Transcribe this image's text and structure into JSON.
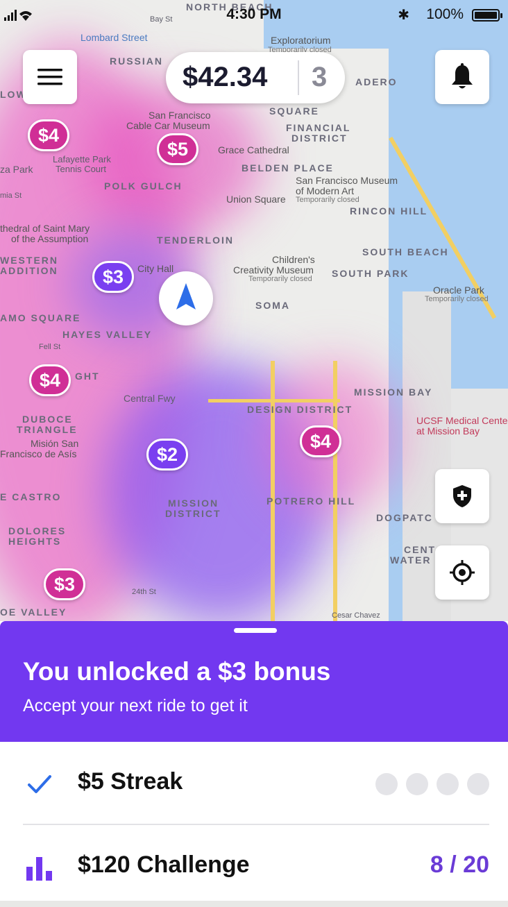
{
  "status_bar": {
    "time": "4:30 PM",
    "battery": "100%"
  },
  "header": {
    "earnings": "$42.34",
    "ride_count": "3"
  },
  "icons": {
    "menu": "menu-icon",
    "notifications": "bell-icon",
    "safety": "shield-icon",
    "recenter": "crosshair-icon",
    "location": "navigation-arrow-icon",
    "check": "check-icon",
    "challenge": "bar-chart-icon"
  },
  "map": {
    "labels": {
      "north_beach": "NORTH BEACH",
      "bay_st": "Bay St",
      "lombard": "Lombard Street",
      "exploratorium": "Exploratorium",
      "exploratorium_closed": "Temporarily closed",
      "russian": "RUSSIAN",
      "embarcadero": "ADERO",
      "square": "SQUARE",
      "financial": "FINANCIAL",
      "district": "DISTRICT",
      "cable_car_1": "San Francisco",
      "cable_car_2": "Cable Car Museum",
      "grace": "Grace Cathedral",
      "lafayette_1": "Lafayette Park",
      "lafayette_2": "Tennis Court",
      "belden": "BELDEN PLACE",
      "sfmoma_1": "San Francisco Museum",
      "sfmoma_2": "of Modern Art",
      "sfmoma_closed": "Temporarily closed",
      "polk_gulch": "POLK GULCH",
      "union_square": "Union Square",
      "rincon": "RINCON HILL",
      "cathedral_1": "thedral of Saint Mary",
      "cathedral_2": "of the Assumption",
      "tenderloin": "TENDERLOIN",
      "south_beach": "SOUTH BEACH",
      "western_1": "WESTERN",
      "western_2": "ADDITION",
      "city_hall": "City Hall",
      "childrens_1": "Children's",
      "childrens_2": "Creativity Museum",
      "childrens_closed": "Temporarily closed",
      "south_park": "SOUTH PARK",
      "oracle": "Oracle Park",
      "oracle_closed": "Temporarily closed",
      "soma": "SOMA",
      "alamo": "AMO SQUARE",
      "hayes": "HAYES VALLEY",
      "mission_bay": "MISSION BAY",
      "central_fwy": "Central Fwy",
      "duboce_1": "DUBOCE",
      "duboce_2": "TRIANGLE",
      "design": "DESIGN DISTRICT",
      "ucsf_1": "UCSF Medical Cente",
      "ucsf_2": "at Mission Bay",
      "mision_1": "Misión San",
      "mision_2": "Francisco de Asís",
      "castro": "E CASTRO",
      "potrero": "POTRERO HILL",
      "mission_d_1": "MISSION",
      "mission_d_2": "DISTRICT",
      "dogpatch": "DOGPATC",
      "dolores_1": "DOLORES",
      "dolores_2": "HEIGHTS",
      "central_w_1": "CENT",
      "central_w_2": "WATER",
      "noe": "OE VALLEY",
      "st_24": "24th St",
      "cesar": "Cesar Chavez",
      "park": "za Park",
      "mia": "mia St",
      "fell": "Fell St",
      "lo": "LOW",
      "ght": "GHT"
    }
  },
  "markers": [
    {
      "label": "$4",
      "color": "#d02f96"
    },
    {
      "label": "$5",
      "color": "#d02f96"
    },
    {
      "label": "$3",
      "color": "#7a3ff0"
    },
    {
      "label": "$4",
      "color": "#d02f96"
    },
    {
      "label": "$2",
      "color": "#7a3ff0"
    },
    {
      "label": "$4",
      "color": "#d02f96"
    },
    {
      "label": "$3",
      "color": "#d02f96"
    }
  ],
  "bonus": {
    "title": "You unlocked a $3 bonus",
    "subtitle": "Accept your next ride to get it",
    "color": "#7238f0"
  },
  "streak": {
    "label": "$5 Streak"
  },
  "challenge": {
    "label": "$120 Challenge",
    "progress": "8 / 20",
    "completed": 8,
    "target": 20
  }
}
